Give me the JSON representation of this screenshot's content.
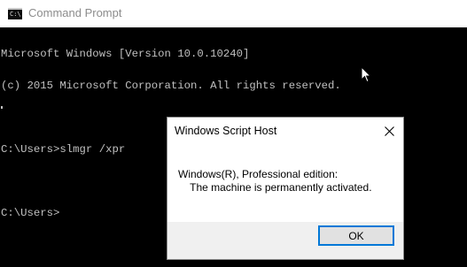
{
  "window": {
    "title": "Command Prompt",
    "icon": "cmd-icon",
    "icon_glyph": "C:\\"
  },
  "console": {
    "lines": [
      "Microsoft Windows [Version 10.0.10240]",
      "(c) 2015 Microsoft Corporation. All rights reserved.",
      "",
      "C:\\Users>slmgr /xpr",
      "",
      "C:\\Users>"
    ]
  },
  "dialog": {
    "title": "Windows Script Host",
    "close_icon": "close-icon",
    "message": "Windows(R), Professional edition:\n    The machine is permanently activated.",
    "ok_label": "OK",
    "accent_color": "#0078d7"
  }
}
